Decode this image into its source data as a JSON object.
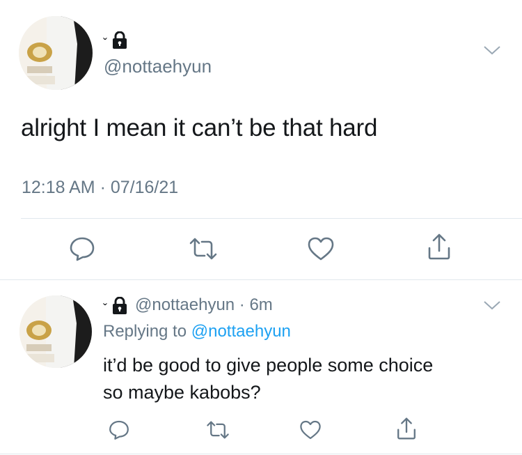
{
  "main_tweet": {
    "handle": "@nottaehyun",
    "text": "alright I mean it can’t be that hard",
    "timestamp": "12:18 AM · 07/16/21",
    "actions": [
      "reply-icon",
      "retweet-icon",
      "like-icon",
      "share-icon"
    ]
  },
  "reply_tweet": {
    "handle_time": "@nottaehyun · 6m",
    "replying_label": "Replying to",
    "replying_handle": "@nottaehyun",
    "text_line1": "it’d be good to give people some choice",
    "text_line2": "so maybe kabobs?",
    "actions": [
      "reply-icon",
      "retweet-icon",
      "like-icon",
      "share-icon"
    ]
  },
  "colors": {
    "text": "#14171a",
    "secondary": "#657786",
    "link": "#1da1f2",
    "divider": "#e1e8ed"
  }
}
